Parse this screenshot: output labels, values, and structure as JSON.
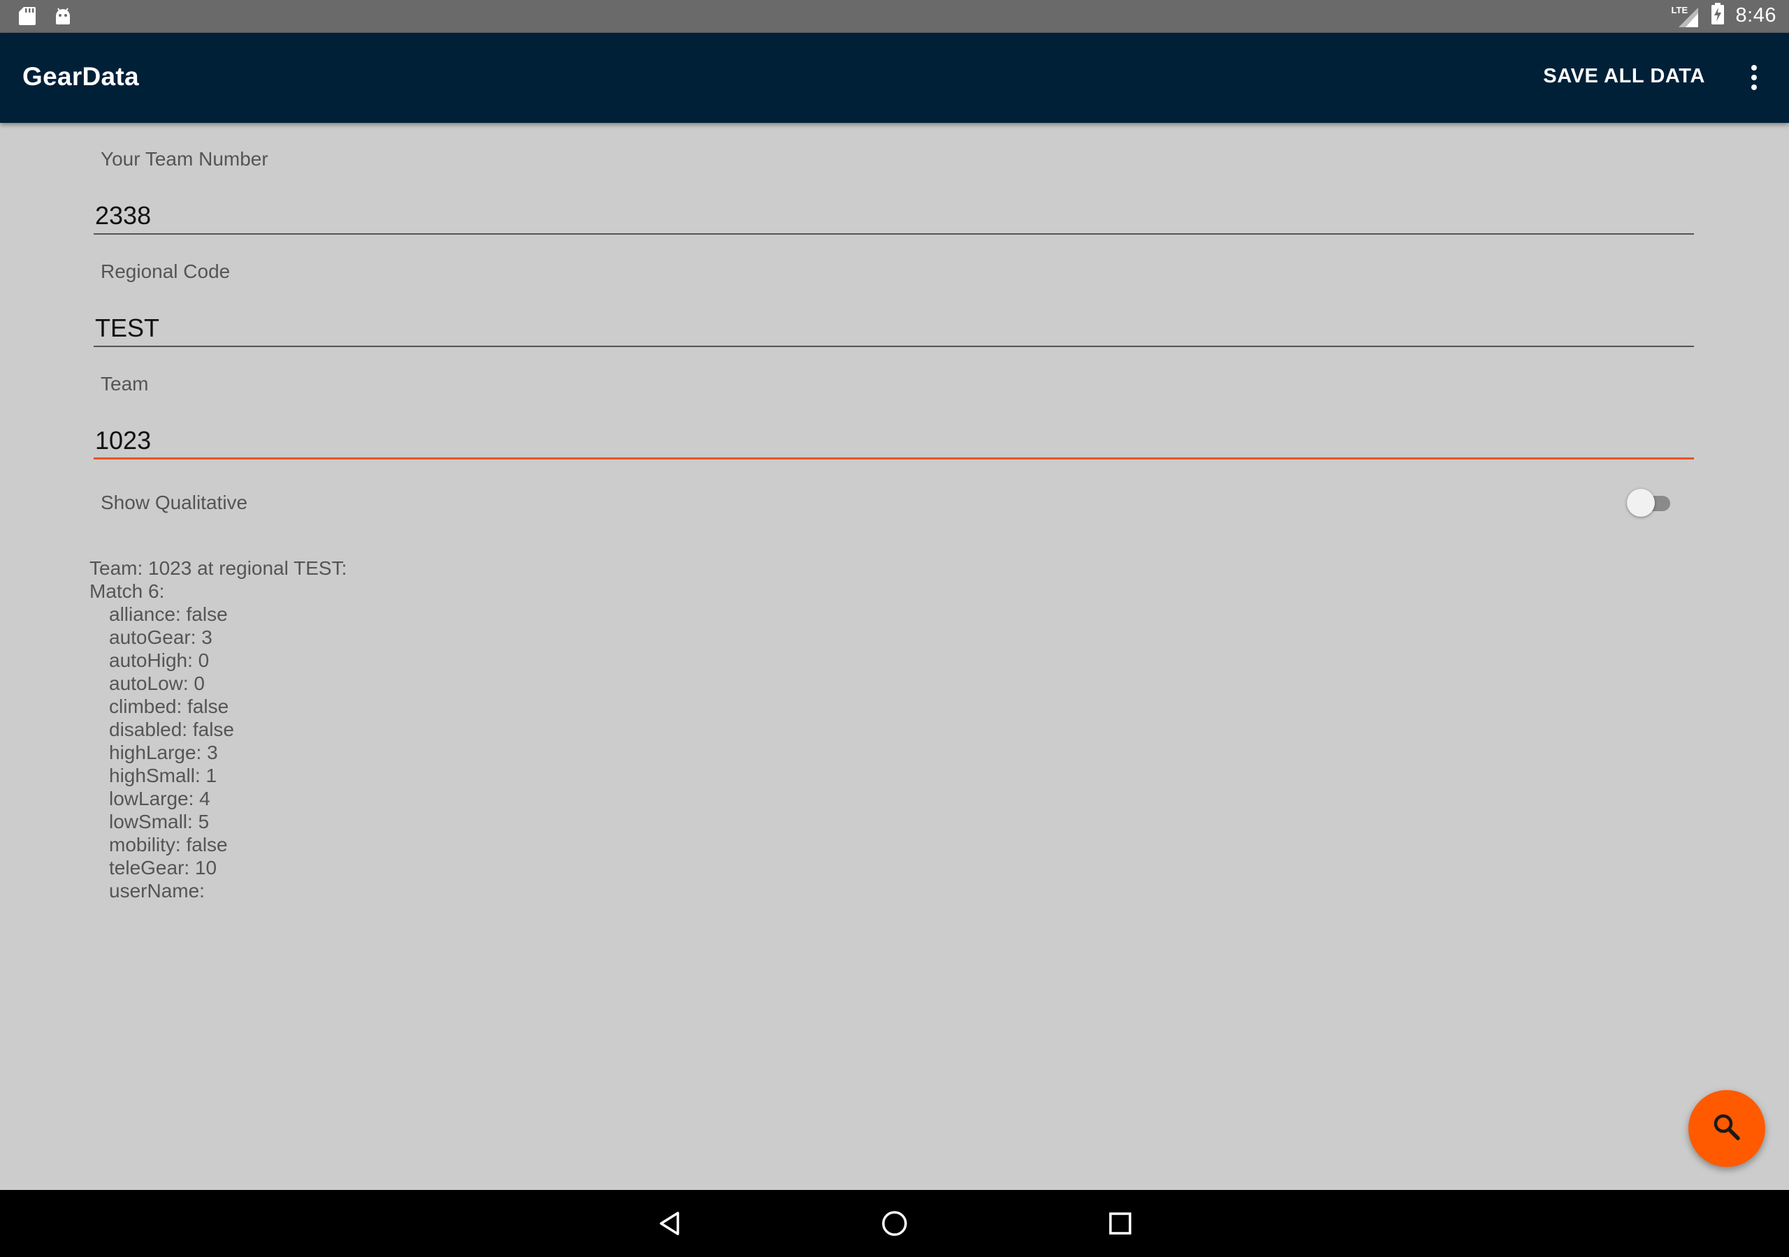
{
  "status_bar": {
    "time": "8:46",
    "network": "LTE",
    "left_icons": [
      "sd-card-icon",
      "android-icon"
    ],
    "right_icons": [
      "lte-signal-icon",
      "battery-charging-icon"
    ]
  },
  "app_bar": {
    "title": "GearData",
    "save_label": "SAVE ALL DATA",
    "overflow_icon": "more-vert-icon",
    "background": "#002038"
  },
  "form": {
    "team_number_label": "Your Team Number",
    "team_number_value": "2338",
    "regional_code_label": "Regional Code",
    "regional_code_value": "TEST",
    "team_label": "Team",
    "team_value": "1023",
    "show_qualitative_label": "Show Qualitative",
    "show_qualitative_on": false,
    "accent_color": "#e8541c"
  },
  "data_output": {
    "header": "Team: 1023 at regional TEST:",
    "match_label": "Match 6:",
    "fields": [
      "alliance: false",
      "autoGear: 3",
      "autoHigh: 0",
      "autoLow: 0",
      "climbed: false",
      "disabled: false",
      "highLarge: 3",
      "highSmall: 1",
      "lowLarge: 4",
      "lowSmall: 5",
      "mobility: false",
      "teleGear: 10",
      "userName:"
    ]
  },
  "fab": {
    "icon": "search-icon",
    "color": "#ff5a00"
  },
  "nav_bar": {
    "icons": [
      "back-icon",
      "home-icon",
      "recents-icon"
    ]
  }
}
